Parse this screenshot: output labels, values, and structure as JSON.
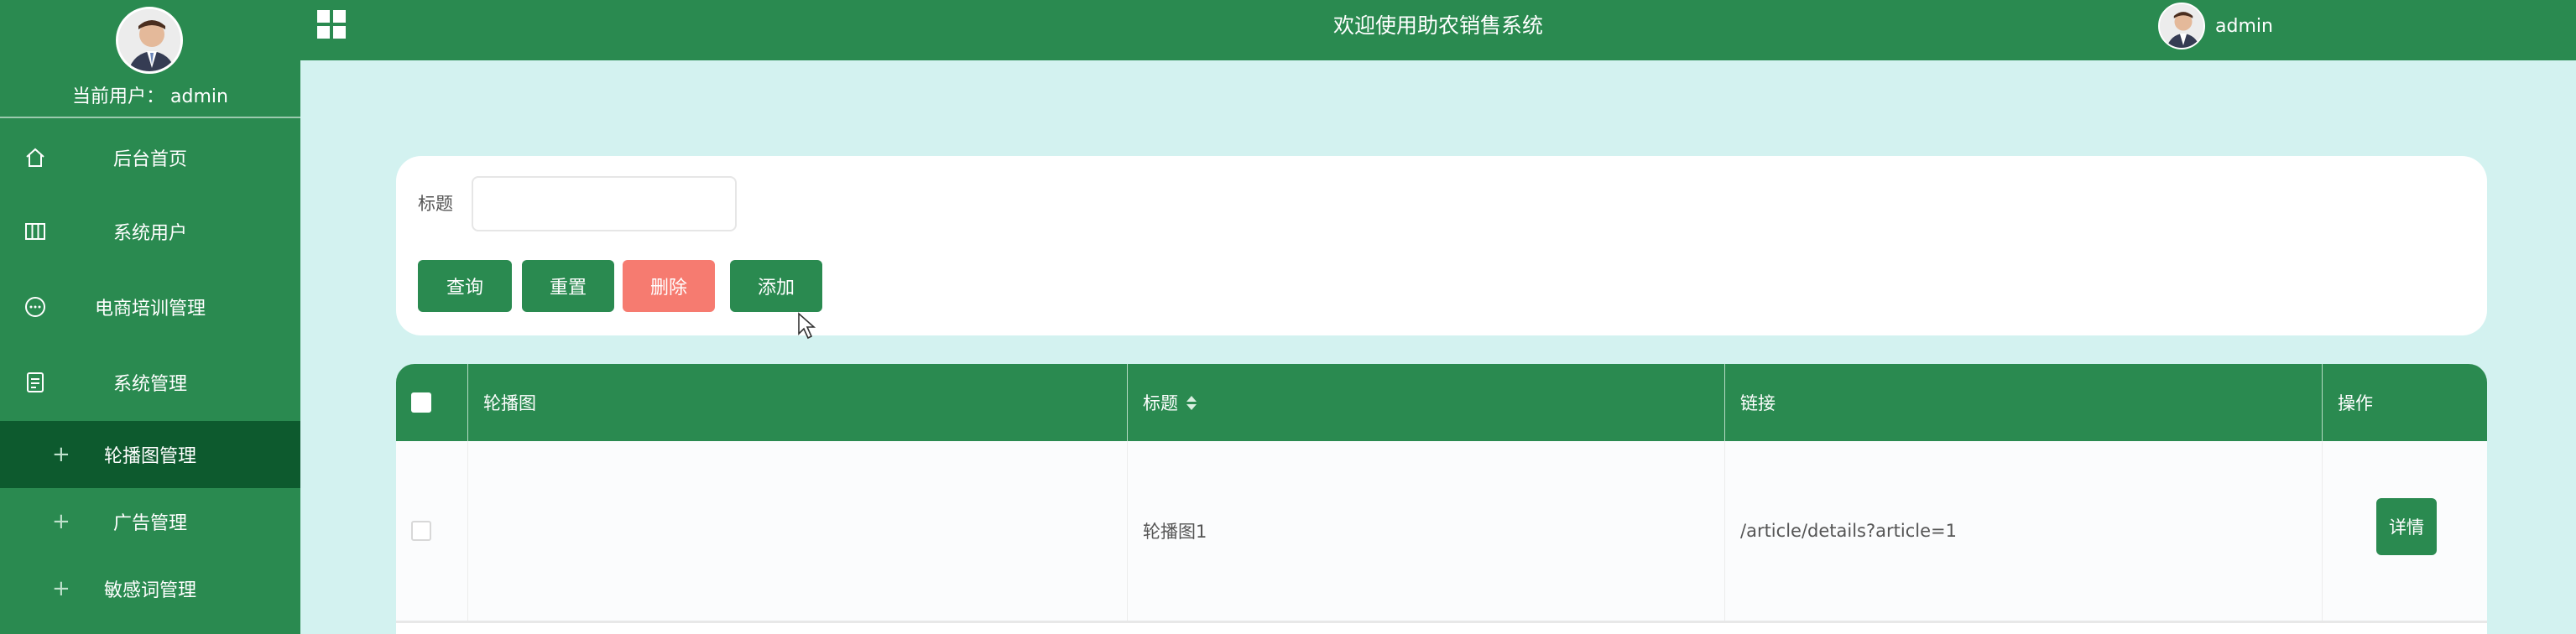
{
  "sidebar": {
    "current_user": "当前用户： admin",
    "items": [
      {
        "label": "后台首页",
        "icon": "home-icon"
      },
      {
        "label": "系统用户",
        "icon": "columns-icon"
      },
      {
        "label": "电商培训管理",
        "icon": "chat-bubble-icon"
      },
      {
        "label": "系统管理",
        "icon": "document-icon"
      }
    ],
    "subitems": [
      {
        "label": "轮播图管理",
        "active": true
      },
      {
        "label": "广告管理",
        "active": false
      },
      {
        "label": "敏感词管理",
        "active": false
      }
    ]
  },
  "header": {
    "title": "欢迎使用助农销售系统",
    "username": "admin"
  },
  "search": {
    "label": "标题",
    "value": "",
    "buttons": {
      "query": "查询",
      "reset": "重置",
      "delete": "删除",
      "add": "添加"
    }
  },
  "table": {
    "columns": [
      "轮播图",
      "标题",
      "链接",
      "操作"
    ],
    "rows": [
      {
        "image": "",
        "title": "轮播图1",
        "link": "/article/details?article=1",
        "action": "详情"
      }
    ]
  },
  "colors": {
    "primary": "#2a8a50",
    "active_sidebar": "#0d5a2e",
    "background": "#d3f2f0",
    "danger": "#f67b70"
  }
}
